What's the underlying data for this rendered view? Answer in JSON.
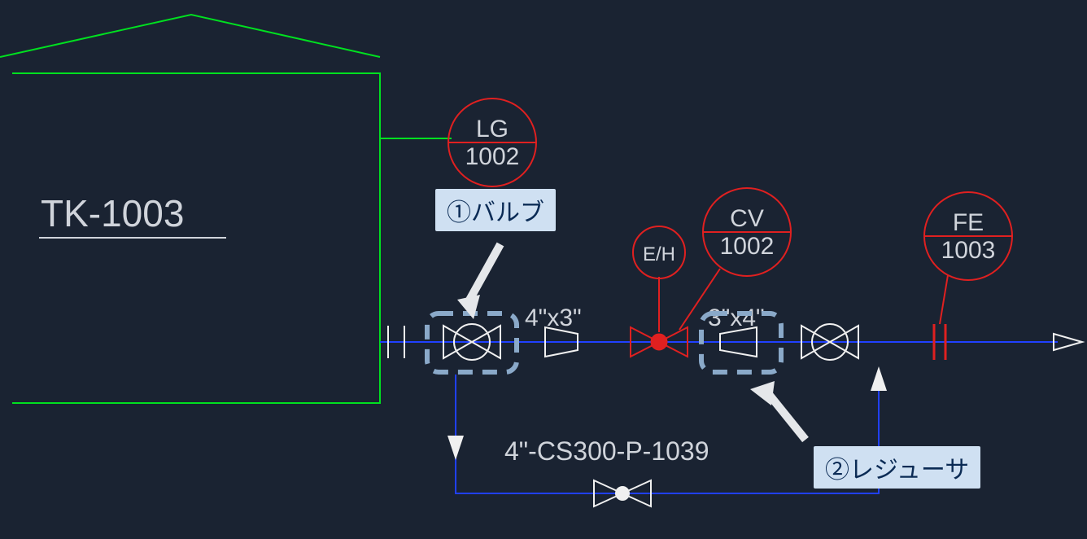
{
  "colors": {
    "bg": "#1a2332",
    "green": "#00e020",
    "blue": "#2040ff",
    "red": "#e02020",
    "white": "#f0f0f0",
    "gray": "#d0d4db",
    "callout_bg": "#cfe0f2",
    "callout_fg": "#0b2b55",
    "dash": "#8aa9c9"
  },
  "tank": {
    "label": "TK-1003"
  },
  "instruments": {
    "lg": {
      "top": "LG",
      "bottom": "1002"
    },
    "cv": {
      "top": "CV",
      "bottom": "1002"
    },
    "fe": {
      "top": "FE",
      "bottom": "1003"
    },
    "eh": {
      "label": "E/H"
    }
  },
  "labels": {
    "reducer1": "4\"x3\"",
    "reducer2": "3\"x4\"",
    "line": "4\"-CS300-P-1039"
  },
  "callouts": {
    "valve": "①バルブ",
    "reducer": "②レジューサ"
  }
}
